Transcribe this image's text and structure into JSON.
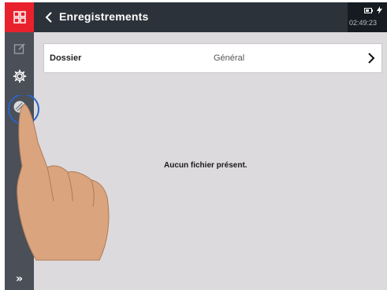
{
  "header": {
    "title": "Enregistrements",
    "time": "02:49:23"
  },
  "sidebar": {
    "items": [
      {
        "icon": "home-grid-icon"
      },
      {
        "icon": "edit-icon"
      },
      {
        "icon": "gear-icon"
      },
      {
        "icon": "record-icon"
      }
    ],
    "expand_icon": "»"
  },
  "folder": {
    "label": "Dossier",
    "value": "Général"
  },
  "main": {
    "empty_message": "Aucun fichier présent."
  },
  "colors": {
    "accent": "#e8212c",
    "sidebar": "#4a4f58",
    "header": "#2c323a",
    "background": "#dcdadd"
  }
}
